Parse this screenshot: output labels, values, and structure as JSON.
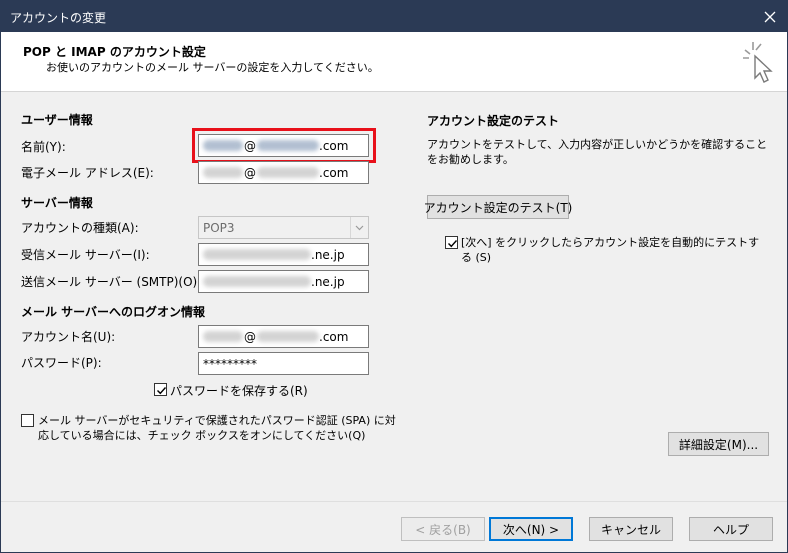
{
  "window": {
    "title": "アカウントの変更",
    "close_glyph": "✕"
  },
  "header": {
    "title": "POP と IMAP のアカウント設定",
    "subtitle": "お使いのアカウントのメール サーバーの設定を入力してください。"
  },
  "user_info": {
    "section_label": "ユーザー情報",
    "name_label": "名前(Y):",
    "name_suffix": "@",
    "name_domain_tail": ".com",
    "email_label": "電子メール アドレス(E):",
    "email_at": "@",
    "email_domain_tail": ".com"
  },
  "server_info": {
    "section_label": "サーバー情報",
    "account_type_label": "アカウントの種類(A):",
    "account_type_value": "POP3",
    "incoming_label": "受信メール サーバー(I):",
    "incoming_tail": ".ne.jp",
    "outgoing_label": "送信メール サーバー (SMTP)(O):",
    "outgoing_tail": ".ne.jp"
  },
  "logon_info": {
    "section_label": "メール サーバーへのログオン情報",
    "account_name_label": "アカウント名(U):",
    "account_at": "@",
    "account_domain_tail": ".com",
    "password_label": "パスワード(P):",
    "password_value": "*********",
    "remember_password_label": "パスワードを保存する(R)",
    "remember_password_checked": true,
    "spa_label": "メール サーバーがセキュリティで保護されたパスワード認証 (SPA) に対応している場合には、チェック ボックスをオンにしてください(Q)",
    "spa_checked": false
  },
  "test_panel": {
    "section_label": "アカウント設定のテスト",
    "description": "アカウントをテストして、入力内容が正しいかどうかを確認することをお勧めします。",
    "test_button_label": "アカウント設定のテスト(T)",
    "auto_test_label": "[次へ] をクリックしたらアカウント設定を自動的にテストする (S)",
    "auto_test_checked": true
  },
  "advanced_button_label": "詳細設定(M)...",
  "footer": {
    "back_label": "< 戻る(B)",
    "next_label": "次へ(N) >",
    "cancel_label": "キャンセル",
    "help_label": "ヘルプ"
  },
  "colors": {
    "titlebar": "#2b3a55",
    "highlight": "#e8101a",
    "accent": "#0078d7"
  }
}
